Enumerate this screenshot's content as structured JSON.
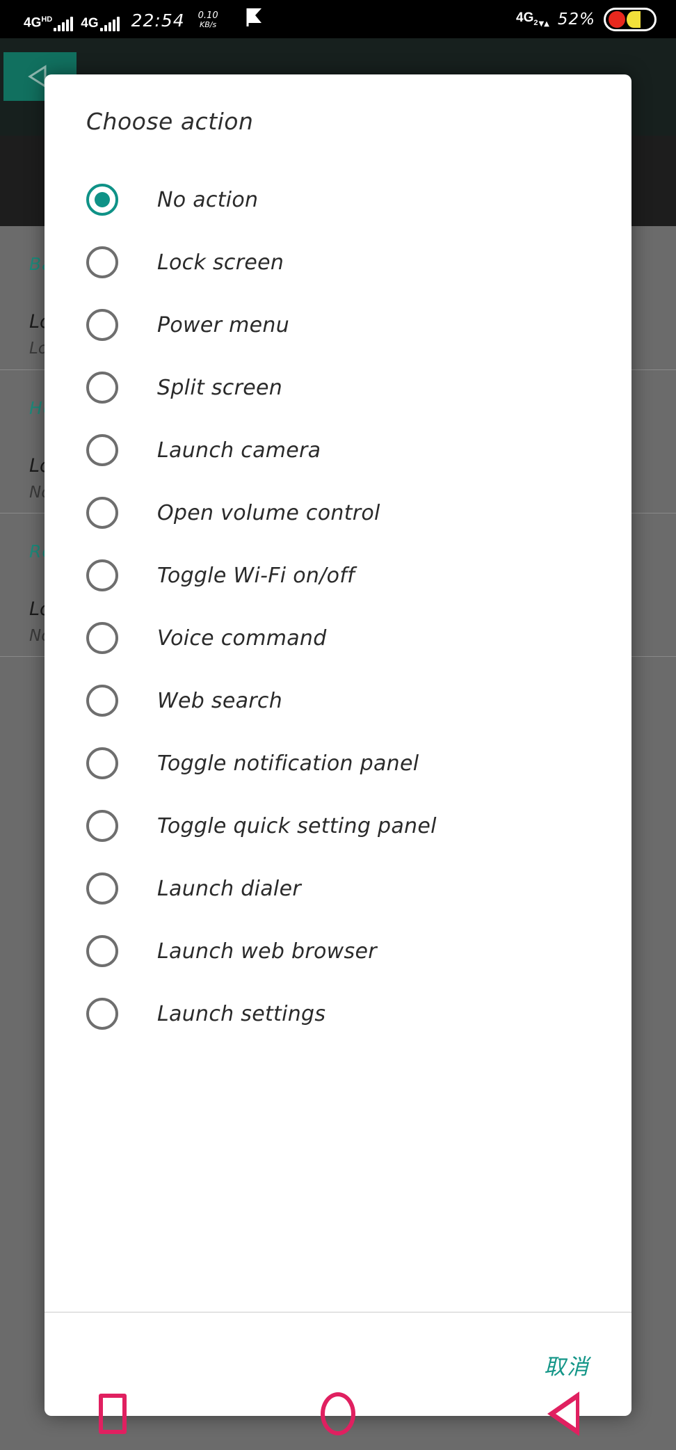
{
  "statusbar": {
    "network_primary": "4G",
    "network_primary_sup": "HD",
    "network_secondary": "4G",
    "clock": "22:54",
    "data_rate_value": "0.10",
    "data_rate_unit": "KB/s",
    "flag_icon": "flag-check-icon",
    "network_right": "4G",
    "network_right_sub": "2",
    "battery_percent": "52%"
  },
  "background": {
    "appbar_back_icon": "back-triangle-icon",
    "sections": [
      {
        "header": "Back",
        "item_title": "Long press action",
        "item_subtitle": "Lock screen"
      },
      {
        "header": "Home",
        "item_title": "Long press action",
        "item_subtitle": "No action"
      },
      {
        "header": "Recents",
        "item_title": "Long press action",
        "item_subtitle": "No action"
      }
    ]
  },
  "dialog": {
    "title": "Choose action",
    "cancel_label": "取消",
    "accent_color": "#0f9287",
    "options": [
      {
        "label": "No action",
        "selected": true
      },
      {
        "label": "Lock screen",
        "selected": false
      },
      {
        "label": "Power menu",
        "selected": false
      },
      {
        "label": "Split screen",
        "selected": false
      },
      {
        "label": "Launch camera",
        "selected": false
      },
      {
        "label": "Open volume control",
        "selected": false
      },
      {
        "label": "Toggle Wi-Fi on/off",
        "selected": false
      },
      {
        "label": "Voice command",
        "selected": false
      },
      {
        "label": "Web search",
        "selected": false
      },
      {
        "label": "Toggle notification panel",
        "selected": false
      },
      {
        "label": "Toggle quick setting panel",
        "selected": false
      },
      {
        "label": "Launch dialer",
        "selected": false
      },
      {
        "label": "Launch web browser",
        "selected": false
      },
      {
        "label": "Launch settings",
        "selected": false
      }
    ]
  },
  "navbar": {
    "recents_icon": "square-recents-icon",
    "home_icon": "circle-home-icon",
    "back_icon": "triangle-back-icon",
    "icon_color": "#e02060"
  }
}
